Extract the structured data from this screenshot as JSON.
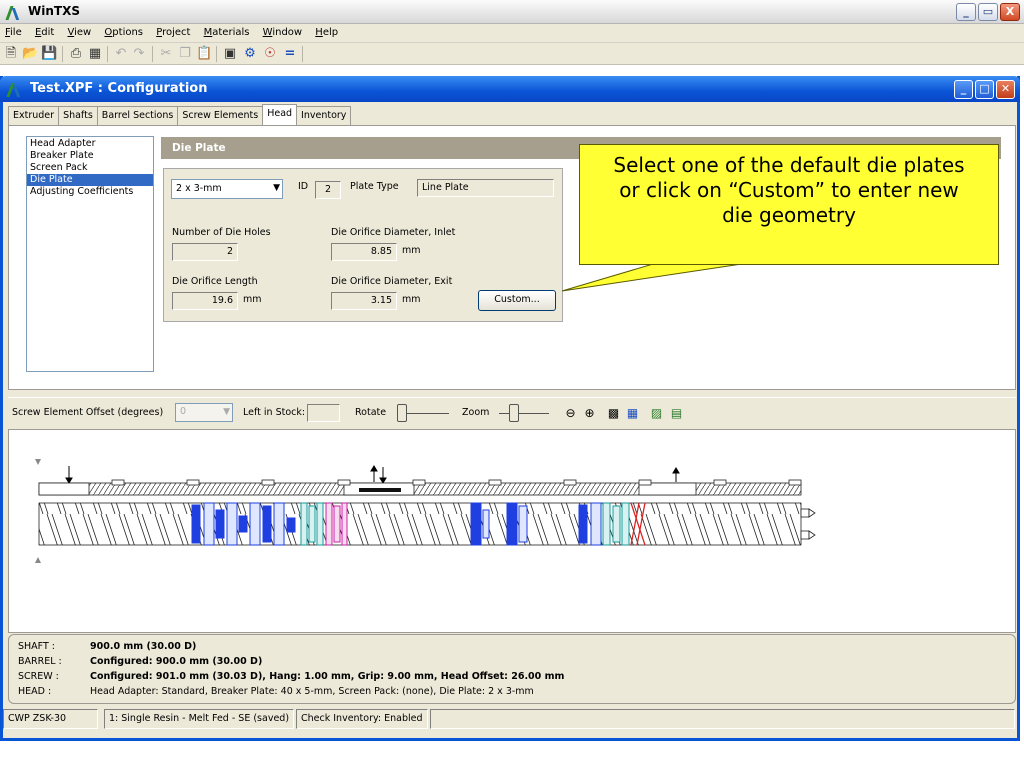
{
  "app": {
    "title": "WinTXS",
    "window_buttons": [
      "_",
      "▭",
      "X"
    ]
  },
  "menu": [
    "File",
    "Edit",
    "View",
    "Options",
    "Project",
    "Materials",
    "Window",
    "Help"
  ],
  "toolbar": {
    "icons": [
      "new-file-icon",
      "open-folder-icon",
      "save-icon",
      "print-icon",
      "print-preview-icon",
      "undo-icon",
      "redo-icon",
      "cut-icon",
      "copy-icon",
      "paste-icon",
      "properties-icon",
      "wizard-icon",
      "globe-icon",
      "equals-icon"
    ]
  },
  "child": {
    "title": "Test.XPF : Configuration",
    "tabs": [
      "Extruder",
      "Shafts",
      "Barrel Sections",
      "Screw Elements",
      "Head",
      "Inventory"
    ],
    "active_tab": "Head"
  },
  "head_list": {
    "items": [
      "Head Adapter",
      "Breaker Plate",
      "Screen Pack",
      "Die Plate",
      "Adjusting Coefficients"
    ],
    "selected": "Die Plate"
  },
  "die_plate": {
    "header": "Die Plate",
    "plate_select": "2 x 3-mm",
    "id_label": "ID",
    "id_value": "2",
    "plate_type_label": "Plate Type",
    "plate_type_value": "Line Plate",
    "holes_label": "Number of Die Holes",
    "holes_value": "2",
    "inlet_label": "Die Orifice Diameter, Inlet",
    "inlet_value": "8.85",
    "inlet_unit": "mm",
    "length_label": "Die Orifice Length",
    "length_value": "19.6",
    "length_unit": "mm",
    "exit_label": "Die Orifice Diameter, Exit",
    "exit_value": "3.15",
    "exit_unit": "mm",
    "custom_button": "Custom..."
  },
  "callout": {
    "line1": "Select one of the default die plates",
    "line2": "or click on “Custom” to enter new",
    "line3": "die geometry"
  },
  "screw_toolbar": {
    "offset_label": "Screw Element Offset (degrees)",
    "offset_value": "0",
    "stock_label": "Left in Stock:",
    "stock_value": "",
    "rotate_label": "Rotate",
    "zoom_label": "Zoom"
  },
  "info": {
    "rows": [
      {
        "key": "SHAFT :",
        "value": "900.0 mm (30.00 D)",
        "bold": true
      },
      {
        "key": "BARREL :",
        "value": "Configured: 900.0 mm (30.00 D)",
        "bold": true
      },
      {
        "key": "SCREW :",
        "value": "Configured: 901.0 mm (30.03 D), Hang: 1.00 mm, Grip: 9.00 mm, Head Offset: 26.00 mm",
        "bold": true
      },
      {
        "key": "HEAD :",
        "value": "Head Adapter: Standard,  Breaker Plate: 40 x 5-mm,  Screen Pack: (none),  Die Plate: 2 x 3-mm",
        "bold": false
      }
    ]
  },
  "status": {
    "cells": [
      "CWP ZSK-30",
      "1: Single Resin - Melt Fed - SE (saved)",
      "Check Inventory: Enabled"
    ]
  },
  "colors": {
    "xp_blue": "#0a54d6",
    "callout_yellow": "#ffff33",
    "kneading_blue": "#1f3fe0",
    "kneading_teal": "#1a9a9a",
    "kneading_magenta": "#cc22aa",
    "reverse_red": "#dd2222"
  }
}
